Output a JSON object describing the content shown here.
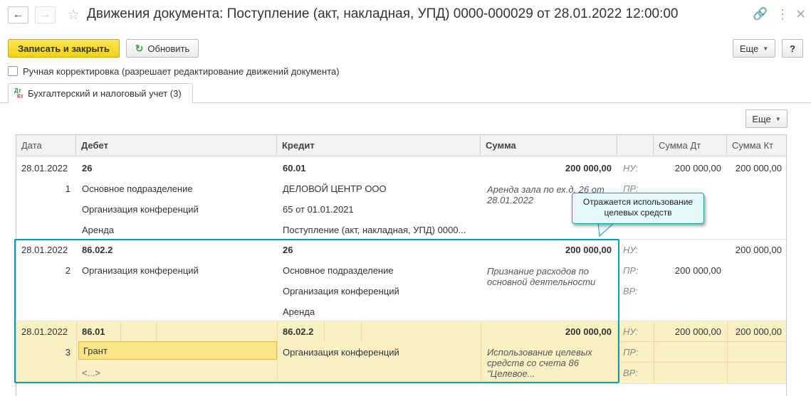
{
  "window": {
    "title": "Движения документа: Поступление (акт, накладная, УПД) 0000-000029 от 28.01.2022 12:00:00",
    "icons": [
      "back-arrow",
      "forward-arrow",
      "star",
      "link",
      "more-vertical",
      "close"
    ]
  },
  "toolbar": {
    "save_close_label": "Записать и закрыть",
    "refresh_label": "Обновить",
    "more_label": "Еще",
    "help_label": "?"
  },
  "manual_correction": {
    "label": "Ручная корректировка (разрешает редактирование движений документа)",
    "checked": false
  },
  "tab": {
    "icon_dt": "Дт",
    "icon_kt": "Кт",
    "label": "Бухгалтерский и налоговый учет (3)"
  },
  "grid_toolbar": {
    "more_label": "Еще"
  },
  "grid": {
    "headers": {
      "date": "Дата",
      "debit": "Дебет",
      "credit": "Кредит",
      "amount": "Сумма",
      "blank": "",
      "amount_dt": "Сумма Дт",
      "amount_kt": "Сумма Кт"
    },
    "rows": [
      {
        "date": "28.01.2022",
        "num": "1",
        "debit_account": "26",
        "debit_sub": [
          "Основное подразделение",
          "Организация конференций",
          "Аренда"
        ],
        "credit_account": "60.01",
        "credit_sub": [
          "ДЕЛОВОЙ ЦЕНТР ООО",
          "65 от 01.01.2021",
          "Поступление (акт, накладная, УПД) 0000..."
        ],
        "amount": "200 000,00",
        "content": "Аренда зала по ех.д. 26 от 28.01.2022",
        "labels": [
          "НУ:",
          "ПР:"
        ],
        "nu_dt": "200 000,00",
        "nu_kt": "200 000,00"
      },
      {
        "date": "28.01.2022",
        "num": "2",
        "debit_account": "86.02.2",
        "debit_sub": [
          "Организация конференций"
        ],
        "credit_account": "26",
        "credit_sub": [
          "Основное подразделение",
          "Организация конференций",
          "Аренда"
        ],
        "amount": "200 000,00",
        "content": "Признание расходов по основной деятельности",
        "labels": [
          "НУ:",
          "ПР:",
          "ВР:"
        ],
        "nu_kt": "200 000,00",
        "pr_dt": "200 000,00"
      },
      {
        "date": "28.01.2022",
        "num": "3",
        "debit_account": "86.01",
        "debit_sub": [
          "Грант",
          "<...>"
        ],
        "credit_account": "86.02.2",
        "credit_sub": [
          "Организация конференций"
        ],
        "amount": "200 000,00",
        "content": "Использование целевых средств со счета 86 \"Целевое...",
        "labels": [
          "НУ:",
          "ПР:",
          "ВР:"
        ],
        "nu_dt": "200 000,00",
        "nu_kt": "200 000,00"
      }
    ]
  },
  "callout": {
    "text": "Отражается использование целевых средств"
  },
  "colors": {
    "primary_button": "#f1d11a",
    "highlight_box": "#0e9bb9",
    "selected_row": "#fbf1c4",
    "callout_bg": "#e4f8fb"
  }
}
